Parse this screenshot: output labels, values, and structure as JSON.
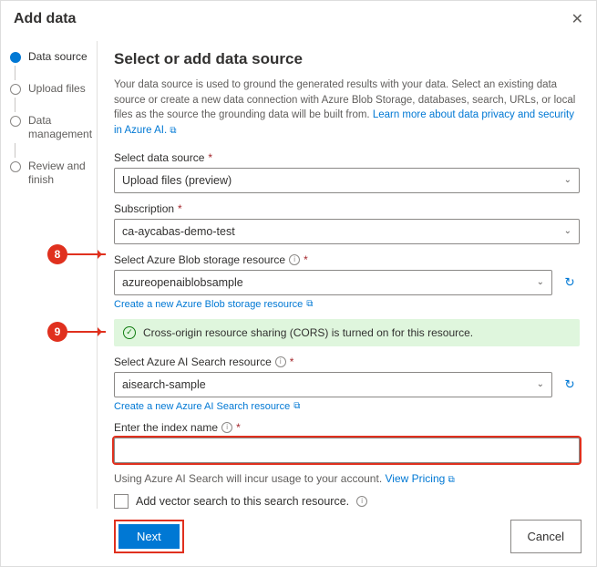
{
  "header": {
    "title": "Add data"
  },
  "stepper": {
    "steps": [
      {
        "label": "Data source",
        "active": true
      },
      {
        "label": "Upload files"
      },
      {
        "label": "Data management"
      },
      {
        "label": "Review and finish"
      }
    ]
  },
  "main": {
    "heading": "Select or add data source",
    "description_prefix": "Your data source is used to ground the generated results with your data. Select an existing data source or create a new data connection with Azure Blob Storage, databases, search, URLs, or local files as the source the grounding data will be built from. ",
    "description_link": "Learn more about data privacy and security in Azure AI."
  },
  "fields": {
    "data_source": {
      "label": "Select data source",
      "value": "Upload files (preview)"
    },
    "subscription": {
      "label": "Subscription",
      "value": "ca-aycabas-demo-test"
    },
    "blob": {
      "label": "Select Azure Blob storage resource",
      "value": "azureopenaiblobsample",
      "create_link": "Create a new Azure Blob storage resource"
    },
    "cors_banner": "Cross-origin resource sharing (CORS) is turned on for this resource.",
    "ai_search": {
      "label": "Select Azure AI Search resource",
      "value": "aisearch-sample",
      "create_link": "Create a new Azure AI Search resource"
    },
    "index": {
      "label": "Enter the index name",
      "value": ""
    },
    "usage_note_prefix": "Using Azure AI Search will incur usage to your account. ",
    "usage_note_link": "View Pricing",
    "vector_checkbox": "Add vector search to this search resource."
  },
  "footer": {
    "next": "Next",
    "cancel": "Cancel"
  },
  "annotations": {
    "callout8": "8",
    "callout9": "9"
  }
}
